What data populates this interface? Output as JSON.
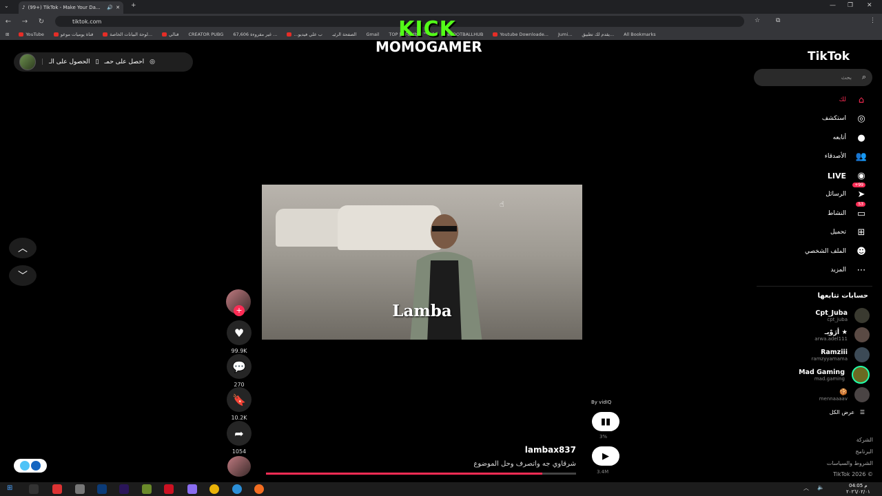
{
  "browser": {
    "tab_title": "(99+) TikTok - Make Your Da...",
    "url": "tiktok.com",
    "bookmarks": [
      "YouTube",
      "قناة يوميات موعو",
      "لوحة البيانات الخاصة...",
      "قنالي",
      "CREATOR PUBG",
      "67,606 غير مقروءة ...",
      "...ب علي فيديو",
      "الصفحة الرئيـ",
      "Gmail",
      "TOP | eFootball™ Of...",
      "eFOOTBALLHUB",
      "Youtube Downloade...",
      "Jumi...",
      "يقدم لك تطبيق..."
    ],
    "all_bookmarks": "All Bookmarks"
  },
  "overlay": {
    "kick": "KICK",
    "streamer": "MOMOGAMER"
  },
  "top_pill": {
    "item1": "الحصول على الـ",
    "item2": "احصل على حمـ"
  },
  "video": {
    "overlay_text": "Lamba",
    "username": "lambax837",
    "caption": "شرقاوي جه واتصرف وحل الموضوع",
    "progress_fraction": 0.89,
    "likes": "99.9K",
    "comments": "270",
    "saves": "10.2K",
    "shares": "1054",
    "follow_plus": "+"
  },
  "vidiq": {
    "by": "By vidIQ",
    "pct": "3%",
    "views": "3.4M"
  },
  "sidebar": {
    "logo": "TikTok",
    "search_placeholder": "بحث",
    "nav": [
      {
        "label": "لك",
        "icon": "home-icon"
      },
      {
        "label": "استكشف",
        "icon": "compass-icon"
      },
      {
        "label": "أتابعه",
        "icon": "following-icon"
      },
      {
        "label": "الأصدقاء",
        "icon": "friends-icon"
      },
      {
        "label": "LIVE",
        "icon": "live-icon"
      },
      {
        "label": "الرسائل",
        "icon": "messages-icon",
        "badge": "+99"
      },
      {
        "label": "النشاط",
        "icon": "activity-icon",
        "badge": "53"
      },
      {
        "label": "تحميل",
        "icon": "upload-icon"
      },
      {
        "label": "الملف الشخصي",
        "icon": "profile-icon"
      },
      {
        "label": "المزيد",
        "icon": "more-icon"
      }
    ],
    "following_title": "حسابات تتابعها",
    "following": [
      {
        "name": "Cpt_Juba",
        "handle": "cpt_juba"
      },
      {
        "name": "أرَوْيـ ★",
        "handle": "arwa.adel111"
      },
      {
        "name": "Ramziii",
        "handle": "ramzyyamama"
      },
      {
        "name": "Mad Gaming",
        "handle": "mad.gaming"
      },
      {
        "name": "🍪",
        "handle": "mennaaaav"
      }
    ],
    "see_all": "عرض الكل",
    "footer": [
      "الشركة",
      "البرنامج",
      "الشروط والسياسات"
    ],
    "copyright": "TikTok 2026 ©"
  },
  "taskbar": {
    "time": "04:05 م",
    "date": "٢٠٢٦/٠٢/٠١"
  }
}
